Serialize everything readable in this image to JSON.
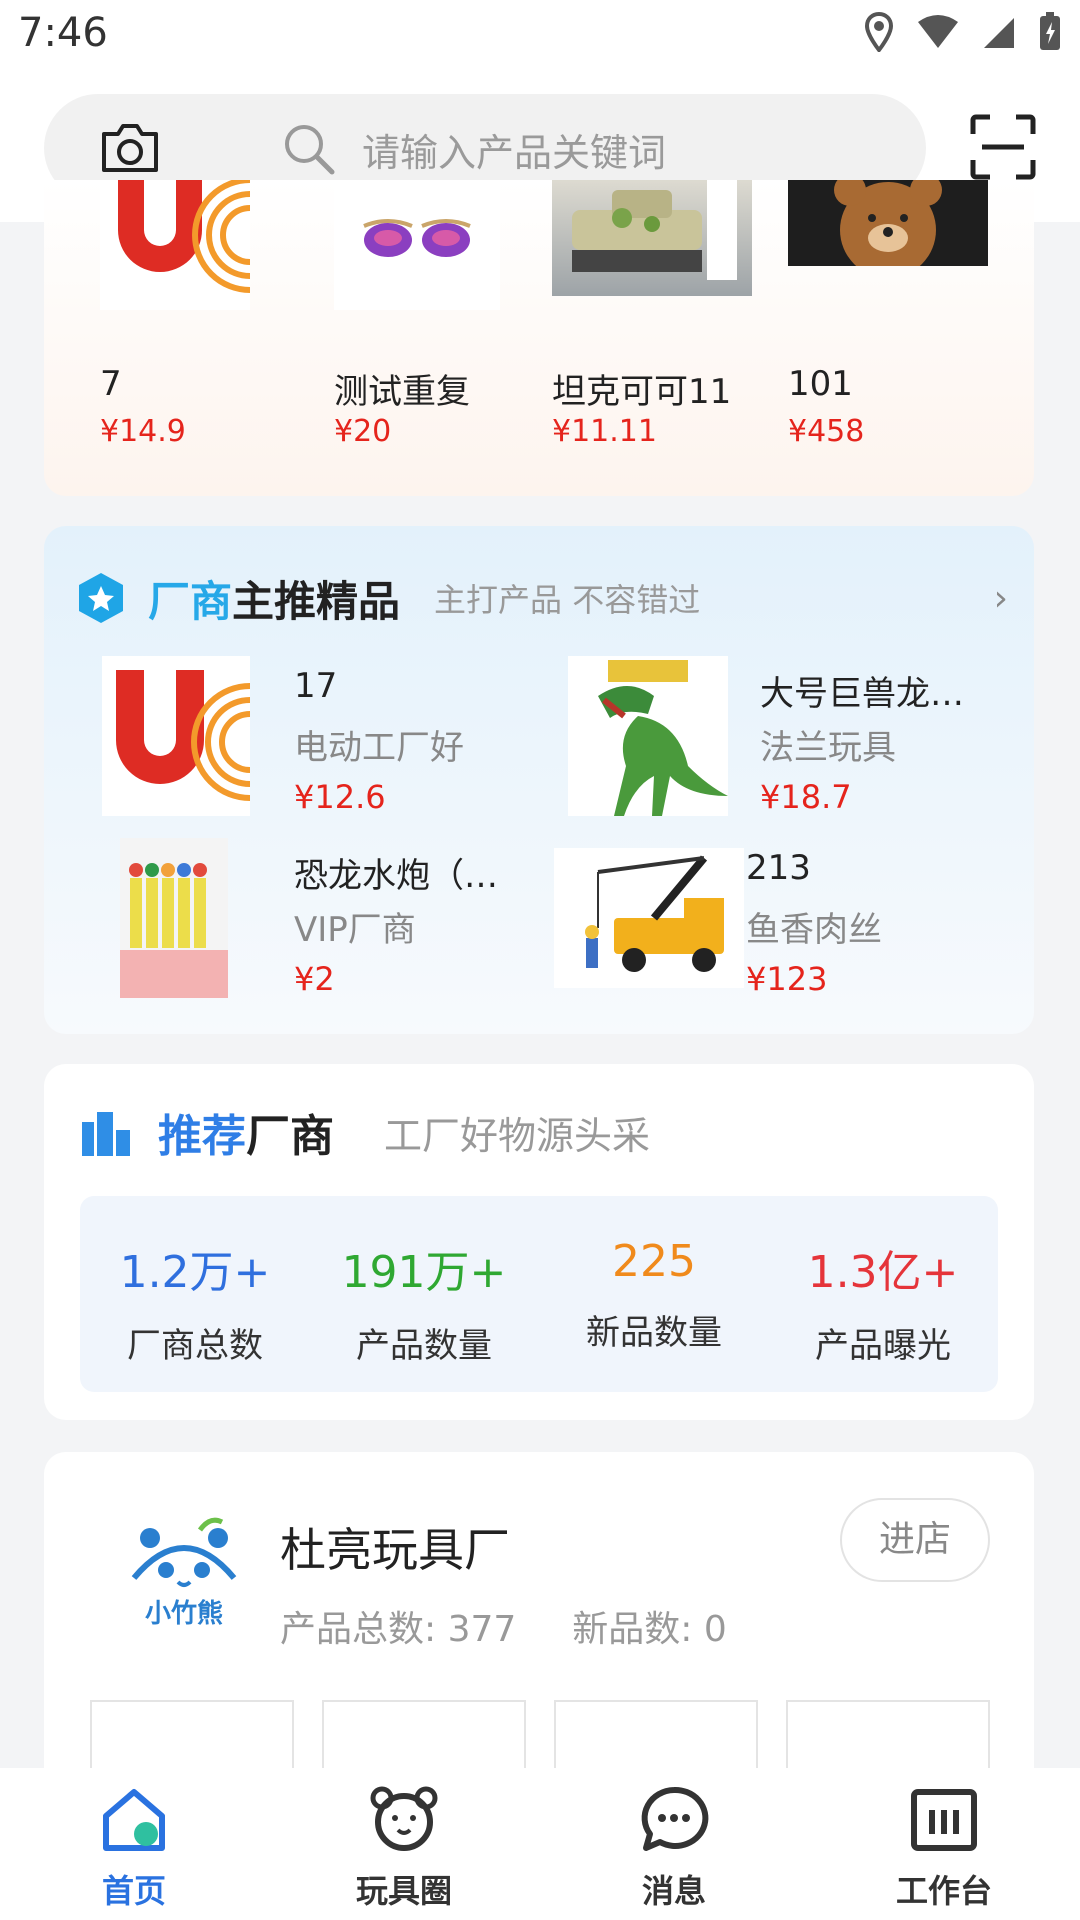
{
  "status": {
    "time": "7:46"
  },
  "search": {
    "placeholder": "请输入产品关键词"
  },
  "hot_products": [
    {
      "name": "7",
      "price": "¥14.9"
    },
    {
      "name": "测试重复",
      "price": "¥20"
    },
    {
      "name": "坦克可可11",
      "price": "¥11.11"
    },
    {
      "name": "101",
      "price": "¥458"
    }
  ],
  "featured": {
    "title_accent": "厂商",
    "title_rest": "主推精品",
    "subtitle": "主打产品 不容错过",
    "items": [
      {
        "title": "17",
        "seller": "电动工厂好",
        "price": "¥12.6"
      },
      {
        "title": "大号巨兽龙…",
        "seller": "法兰玩具",
        "price": "¥18.7"
      },
      {
        "title": "恐龙水炮（…",
        "seller": "VIP厂商",
        "price": "¥2"
      },
      {
        "title": "213",
        "seller": "鱼香肉丝",
        "price": "¥123"
      }
    ]
  },
  "recommend": {
    "title_accent": "推荐",
    "title_rest": "厂商",
    "subtitle": "工厂好物源头采",
    "stats": [
      {
        "value": "1.2万+",
        "label": "厂商总数",
        "color": "#2f6fde"
      },
      {
        "value": "191万+",
        "label": "产品数量",
        "color": "#2fa832"
      },
      {
        "value": "225",
        "label": "新品数量",
        "color": "#f08a1c"
      },
      {
        "value": "1.3亿+",
        "label": "产品曝光",
        "color": "#e5343a"
      }
    ]
  },
  "factory": {
    "name": "杜亮玩具厂",
    "enter_label": "进店",
    "total_label": "产品总数: 377",
    "new_label": "新品数: 0",
    "logo_text": "小竹熊"
  },
  "tabs": [
    {
      "label": "首页",
      "icon": "home-icon",
      "active": true
    },
    {
      "label": "玩具圈",
      "icon": "bear-icon",
      "active": false
    },
    {
      "label": "消息",
      "icon": "chat-icon",
      "active": false
    },
    {
      "label": "工作台",
      "icon": "dashboard-icon",
      "active": false
    }
  ]
}
